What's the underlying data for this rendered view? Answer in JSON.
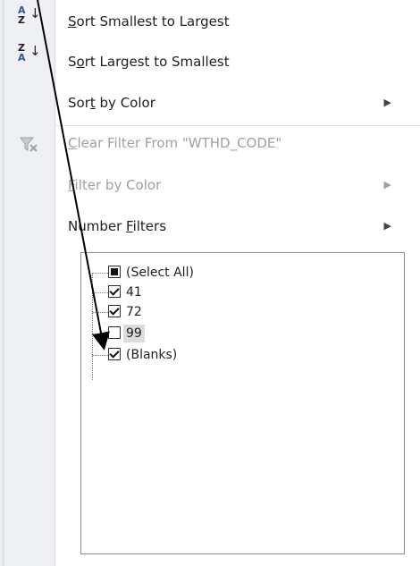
{
  "menu": {
    "sort_asc": {
      "prefix": "",
      "key": "S",
      "rest": "ort Smallest to Largest",
      "icon": "sort-ascending-icon"
    },
    "sort_desc": {
      "prefix": "S",
      "key": "o",
      "rest": "rt Largest to Smallest",
      "icon": "sort-descending-icon"
    },
    "sort_color": {
      "prefix": "Sor",
      "key": "t",
      "rest": " by Color"
    },
    "clear_filter": {
      "prefix": "",
      "key": "C",
      "rest": "lear Filter From \"WTHD_CODE\"",
      "icon": "clear-filter-icon"
    },
    "filter_color": {
      "prefix": "",
      "key": "F",
      "rest": "ilter by Color"
    },
    "number_filters": {
      "prefix": "Number ",
      "key": "F",
      "rest": "ilters"
    },
    "submenu_glyph": "▶"
  },
  "filter_list": {
    "items": [
      {
        "label": "(Select All)",
        "state": "mixed"
      },
      {
        "label": "41",
        "state": "checked"
      },
      {
        "label": "72",
        "state": "checked"
      },
      {
        "label": "99",
        "state": "unchecked"
      },
      {
        "label": "(Blanks)",
        "state": "checked"
      }
    ]
  },
  "icons": {
    "sort_asc_top": "A",
    "sort_asc_bottom": "Z",
    "sort_desc_top": "Z",
    "sort_desc_bottom": "A",
    "arrow": "↓"
  },
  "colors": {
    "annotation_line": "#000000",
    "highlight": "#dcdcdc",
    "disabled_text": "#a0a0a0"
  }
}
